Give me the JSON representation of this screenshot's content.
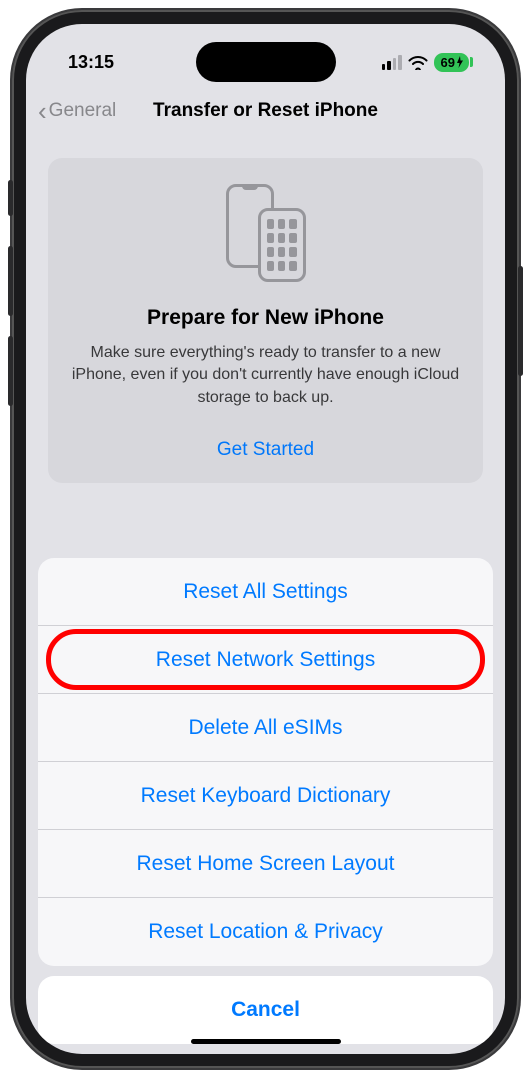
{
  "status": {
    "time": "13:15",
    "battery": "69"
  },
  "nav": {
    "back": "General",
    "title": "Transfer or Reset iPhone"
  },
  "card": {
    "title": "Prepare for New iPhone",
    "text": "Make sure everything's ready to transfer to a new iPhone, even if you don't currently have enough iCloud storage to back up.",
    "cta": "Get Started"
  },
  "sheet": {
    "options": [
      "Reset All Settings",
      "Reset Network Settings",
      "Delete All eSIMs",
      "Reset Keyboard Dictionary",
      "Reset Home Screen Layout",
      "Reset Location & Privacy"
    ],
    "cancel": "Cancel"
  },
  "highlight_index": 1
}
